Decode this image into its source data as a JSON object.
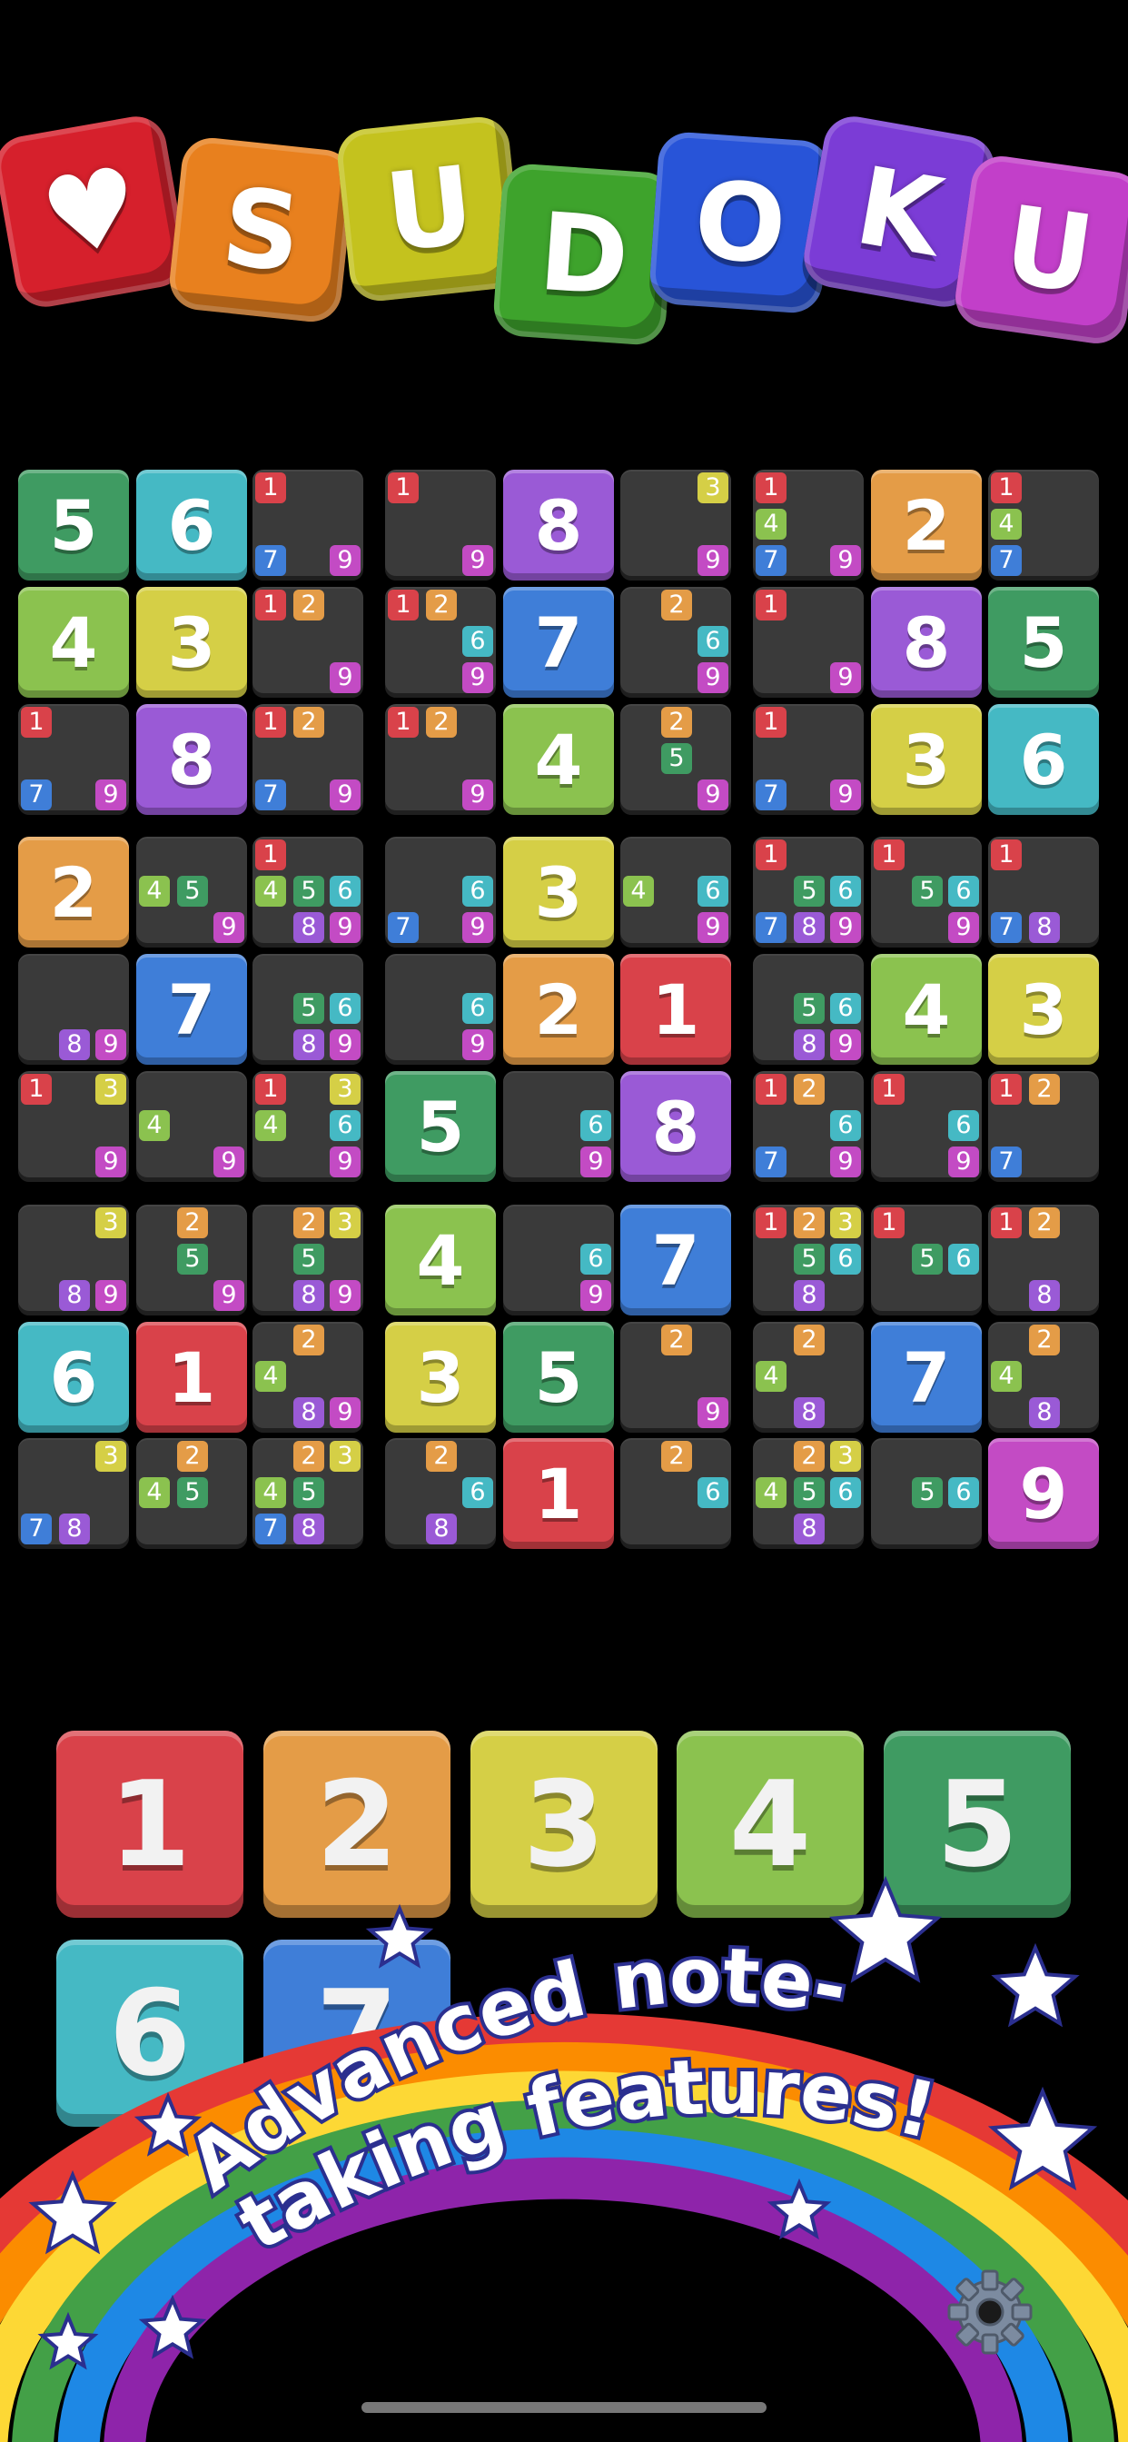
{
  "title": {
    "logo": [
      {
        "char": "♥",
        "color": "#d6202c"
      },
      {
        "char": "S",
        "color": "#e8801e"
      },
      {
        "char": "U",
        "color": "#c4c21e"
      },
      {
        "char": "D",
        "color": "#3ea32c"
      },
      {
        "char": "O",
        "color": "#2854d8"
      },
      {
        "char": "K",
        "color": "#7b3cd6"
      },
      {
        "char": "U",
        "color": "#c23fc9"
      }
    ]
  },
  "digit_colors": {
    "1": "#d9424a",
    "2": "#e49c47",
    "3": "#d5cf46",
    "4": "#8bc24f",
    "5": "#3f9b62",
    "6": "#45b9c4",
    "7": "#3f7ed8",
    "8": "#9a5ad6",
    "9": "#c34bc4"
  },
  "board": [
    [
      {
        "v": 5
      },
      {
        "v": 6
      },
      {
        "n": [
          1,
          7,
          9
        ]
      },
      {
        "n": [
          1,
          9
        ]
      },
      {
        "v": 8
      },
      {
        "n": [
          3,
          9
        ]
      },
      {
        "n": [
          1,
          4,
          7,
          9
        ]
      },
      {
        "v": 2
      },
      {
        "n": [
          1,
          4,
          7
        ]
      }
    ],
    [
      {
        "v": 4
      },
      {
        "v": 3
      },
      {
        "n": [
          1,
          2,
          9
        ]
      },
      {
        "n": [
          1,
          2,
          6,
          9
        ]
      },
      {
        "v": 7
      },
      {
        "n": [
          2,
          6,
          9
        ]
      },
      {
        "n": [
          1,
          9
        ]
      },
      {
        "v": 8
      },
      {
        "v": 5
      }
    ],
    [
      {
        "n": [
          1,
          7,
          9
        ]
      },
      {
        "v": 8
      },
      {
        "n": [
          1,
          2,
          7,
          9
        ]
      },
      {
        "n": [
          1,
          2,
          9
        ]
      },
      {
        "v": 4
      },
      {
        "n": [
          2,
          5,
          9
        ]
      },
      {
        "n": [
          1,
          7,
          9
        ]
      },
      {
        "v": 3
      },
      {
        "v": 6
      }
    ],
    [
      {
        "v": 2
      },
      {
        "n": [
          4,
          5,
          9
        ]
      },
      {
        "n": [
          1,
          4,
          5,
          6,
          8,
          9
        ]
      },
      {
        "n": [
          6,
          7,
          9
        ]
      },
      {
        "v": 3
      },
      {
        "n": [
          4,
          6,
          9
        ]
      },
      {
        "n": [
          1,
          5,
          6,
          7,
          8,
          9
        ]
      },
      {
        "n": [
          1,
          5,
          6,
          9
        ]
      },
      {
        "n": [
          1,
          7,
          8
        ]
      }
    ],
    [
      {
        "n": [
          8,
          9
        ]
      },
      {
        "v": 7
      },
      {
        "n": [
          5,
          6,
          8,
          9
        ]
      },
      {
        "n": [
          6,
          9
        ]
      },
      {
        "v": 2
      },
      {
        "v": 1
      },
      {
        "n": [
          5,
          6,
          8,
          9
        ]
      },
      {
        "v": 4
      },
      {
        "v": 3
      }
    ],
    [
      {
        "n": [
          1,
          3,
          9
        ]
      },
      {
        "n": [
          4,
          9
        ]
      },
      {
        "n": [
          1,
          3,
          4,
          6,
          9
        ]
      },
      {
        "v": 5
      },
      {
        "n": [
          6,
          9
        ]
      },
      {
        "v": 8
      },
      {
        "n": [
          1,
          2,
          6,
          7,
          9
        ]
      },
      {
        "n": [
          1,
          6,
          9
        ]
      },
      {
        "n": [
          1,
          2,
          7
        ]
      }
    ],
    [
      {
        "n": [
          3,
          8,
          9
        ]
      },
      {
        "n": [
          2,
          5,
          9
        ]
      },
      {
        "n": [
          2,
          3,
          5,
          8,
          9
        ]
      },
      {
        "v": 4
      },
      {
        "n": [
          6,
          9
        ]
      },
      {
        "v": 7
      },
      {
        "n": [
          1,
          2,
          3,
          5,
          6,
          8
        ]
      },
      {
        "n": [
          1,
          5,
          6
        ]
      },
      {
        "n": [
          1,
          2,
          8
        ]
      }
    ],
    [
      {
        "v": 6
      },
      {
        "v": 1
      },
      {
        "n": [
          2,
          4,
          8,
          9
        ]
      },
      {
        "v": 3
      },
      {
        "v": 5
      },
      {
        "n": [
          2,
          9
        ]
      },
      {
        "n": [
          2,
          4,
          8
        ]
      },
      {
        "v": 7
      },
      {
        "n": [
          2,
          4,
          8
        ]
      }
    ],
    [
      {
        "n": [
          3,
          7,
          8
        ]
      },
      {
        "n": [
          2,
          4,
          5
        ]
      },
      {
        "n": [
          2,
          3,
          4,
          5,
          7,
          8
        ]
      },
      {
        "n": [
          2,
          6,
          8
        ]
      },
      {
        "v": 1
      },
      {
        "n": [
          2,
          6
        ]
      },
      {
        "n": [
          2,
          3,
          4,
          5,
          6,
          8
        ]
      },
      {
        "n": [
          5,
          6
        ]
      },
      {
        "v": 9
      }
    ]
  ],
  "number_pad": [
    {
      "label": "1",
      "color": "#d9424a"
    },
    {
      "label": "2",
      "color": "#e49c47"
    },
    {
      "label": "3",
      "color": "#d5cf46"
    },
    {
      "label": "4",
      "color": "#8bc24f"
    },
    {
      "label": "5",
      "color": "#3f9b62"
    },
    {
      "label": "6",
      "color": "#45b9c4"
    },
    {
      "label": "7",
      "color": "#3f7ed8"
    }
  ],
  "banner": {
    "line1": "Advanced note-",
    "line2": "taking features!",
    "rainbow_colors": [
      "#e53935",
      "#fb8c00",
      "#fdd835",
      "#43a047",
      "#1e88e5",
      "#8e24aa"
    ]
  },
  "icons": {
    "settings": "gear-icon",
    "stars": "star-icon"
  }
}
